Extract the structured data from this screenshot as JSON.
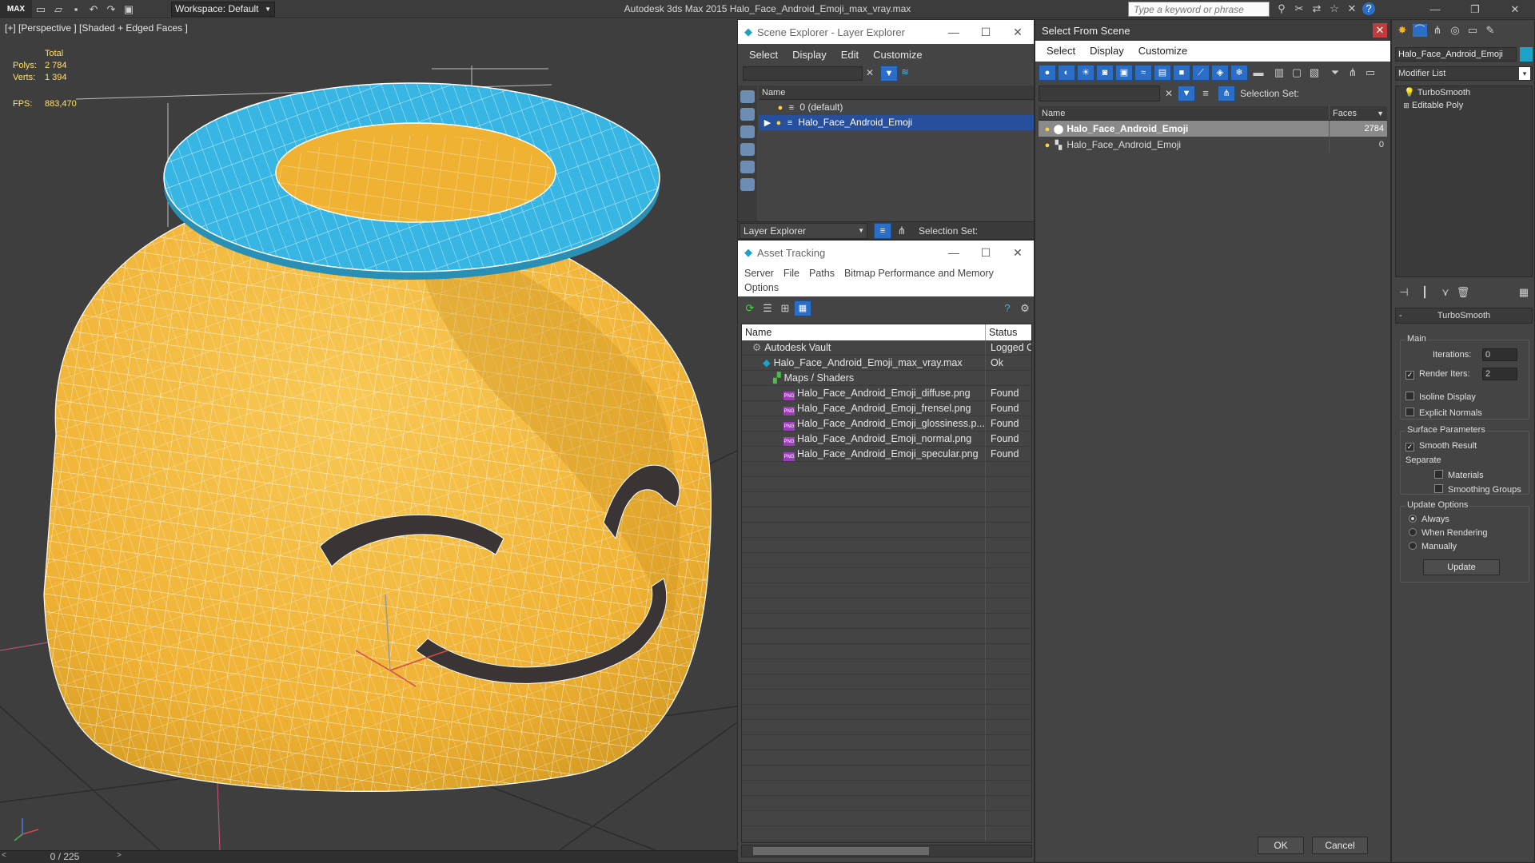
{
  "app": {
    "title": "Autodesk 3ds Max  2015    Halo_Face_Android_Emoji_max_vray.max",
    "logo": "MAX",
    "workspace": "Workspace: Default",
    "search_placeholder": "Type a keyword or phrase"
  },
  "viewport": {
    "label": "[+] [Perspective ] [Shaded + Edged Faces ]",
    "stats": {
      "total_label": "Total",
      "polys_label": "Polys:",
      "polys_value": "2 784",
      "verts_label": "Verts:",
      "verts_value": "1 394",
      "fps_label": "FPS:",
      "fps_value": "883,470"
    },
    "timeline": "0 / 225",
    "colors": {
      "body": "#f2b63a",
      "halo": "#37b6e3",
      "mouth": "#3a3434",
      "wire": "#ffffff"
    }
  },
  "layer_explorer": {
    "title": "Scene Explorer - Layer Explorer",
    "menu": [
      "Select",
      "Display",
      "Edit",
      "Customize"
    ],
    "column_name": "Name",
    "rows": [
      "0 (default)",
      "Halo_Face_Android_Emoji"
    ],
    "footer_dropdown": "Layer Explorer",
    "selection_set_label": "Selection Set:"
  },
  "asset_tracking": {
    "title": "Asset Tracking",
    "menu": [
      "Server",
      "File",
      "Paths",
      "Bitmap Performance and Memory"
    ],
    "menu2": [
      "Options"
    ],
    "col_name": "Name",
    "col_status": "Status",
    "rows": [
      {
        "name": "Autodesk Vault",
        "status": "Logged O",
        "indent": 1,
        "icon": "vault"
      },
      {
        "name": "Halo_Face_Android_Emoji_max_vray.max",
        "status": "Ok",
        "indent": 2,
        "icon": "max"
      },
      {
        "name": "Maps / Shaders",
        "status": "",
        "indent": 3,
        "icon": "maps"
      },
      {
        "name": "Halo_Face_Android_Emoji_diffuse.png",
        "status": "Found",
        "indent": 4,
        "icon": "png"
      },
      {
        "name": "Halo_Face_Android_Emoji_frensel.png",
        "status": "Found",
        "indent": 4,
        "icon": "png"
      },
      {
        "name": "Halo_Face_Android_Emoji_glossiness.p...",
        "status": "Found",
        "indent": 4,
        "icon": "png"
      },
      {
        "name": "Halo_Face_Android_Emoji_normal.png",
        "status": "Found",
        "indent": 4,
        "icon": "png"
      },
      {
        "name": "Halo_Face_Android_Emoji_specular.png",
        "status": "Found",
        "indent": 4,
        "icon": "png"
      }
    ],
    "empty_rows": 25
  },
  "select_from_scene": {
    "title": "Select From Scene",
    "menu": [
      "Select",
      "Display",
      "Customize"
    ],
    "selection_set_label": "Selection Set:",
    "col_name": "Name",
    "col_faces": "Faces",
    "rows": [
      {
        "name": "Halo_Face_Android_Emoji",
        "faces": "2784",
        "selected": true
      },
      {
        "name": "Halo_Face_Android_Emoji",
        "faces": "0",
        "selected": false
      }
    ],
    "ok": "OK",
    "cancel": "Cancel"
  },
  "command_panel": {
    "object_name": "Halo_Face_Android_Emoji",
    "object_color": "#1ea3c8",
    "modifier_list": "Modifier List",
    "stack": [
      "TurboSmooth",
      "Editable Poly"
    ],
    "rollout_title": "TurboSmooth",
    "main_group": "Main",
    "iterations_label": "Iterations:",
    "iterations_value": "0",
    "render_iters_label": "Render Iters:",
    "render_iters_value": "2",
    "isoline_label": "Isoline Display",
    "explicit_label": "Explicit Normals",
    "surface_group": "Surface Parameters",
    "smooth_result_label": "Smooth Result",
    "separate_label": "Separate",
    "materials_label": "Materials",
    "smoothing_label": "Smoothing Groups",
    "update_group": "Update Options",
    "always_label": "Always",
    "when_rendering_label": "When Rendering",
    "manually_label": "Manually",
    "update_button": "Update"
  }
}
